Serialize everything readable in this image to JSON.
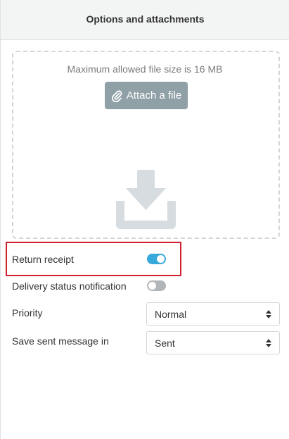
{
  "header": {
    "title": "Options and attachments"
  },
  "attachments": {
    "max_size_text": "Maximum allowed file size is 16 MB",
    "attach_button_label": "Attach a file",
    "attach_icon": "paperclip-icon",
    "drop_icon": "download-icon"
  },
  "options": {
    "return_receipt": {
      "label": "Return receipt",
      "enabled": true
    },
    "delivery_status": {
      "label": "Delivery status notification",
      "enabled": false
    },
    "priority": {
      "label": "Priority",
      "value": "Normal"
    },
    "save_sent": {
      "label": "Save sent message in",
      "value": "Sent"
    }
  },
  "colors": {
    "toggle_on": "#37a8da",
    "toggle_off": "#b3b6b9",
    "button_bg": "#8fa0a6",
    "highlight": "#d0212e"
  }
}
